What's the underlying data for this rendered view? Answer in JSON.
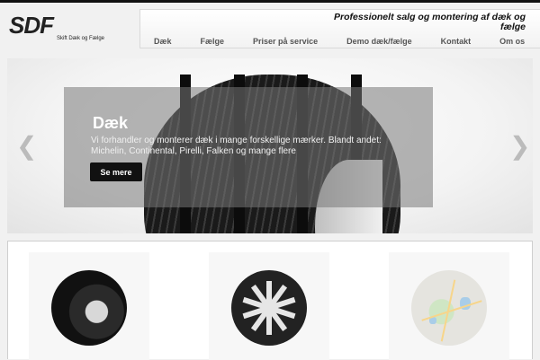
{
  "logo": {
    "mark": "SDF",
    "subtitle": "Skift Dæk og Fælge"
  },
  "header": {
    "tagline": "Professionelt salg og montering af dæk og fælge"
  },
  "nav": {
    "items": [
      {
        "label": "Dæk"
      },
      {
        "label": "Fælge"
      },
      {
        "label": "Priser på service"
      },
      {
        "label": "Demo dæk/fælge"
      },
      {
        "label": "Kontakt"
      },
      {
        "label": "Om os"
      }
    ]
  },
  "slider": {
    "title": "Dæk",
    "text": "Vi forhandler og monterer dæk i mange forskellige mærker. Blandt andet: Michelin, Continental, Pirelli, Falken og mange flere",
    "button_label": "Se mere",
    "prev_icon": "chevron-left-icon",
    "next_icon": "chevron-right-icon"
  },
  "cards": [
    {
      "icon": "tire-image"
    },
    {
      "icon": "rim-image"
    },
    {
      "icon": "map-image"
    }
  ],
  "colors": {
    "accent": "#111111",
    "nav_text": "#555555",
    "caption_overlay": "#787878"
  }
}
